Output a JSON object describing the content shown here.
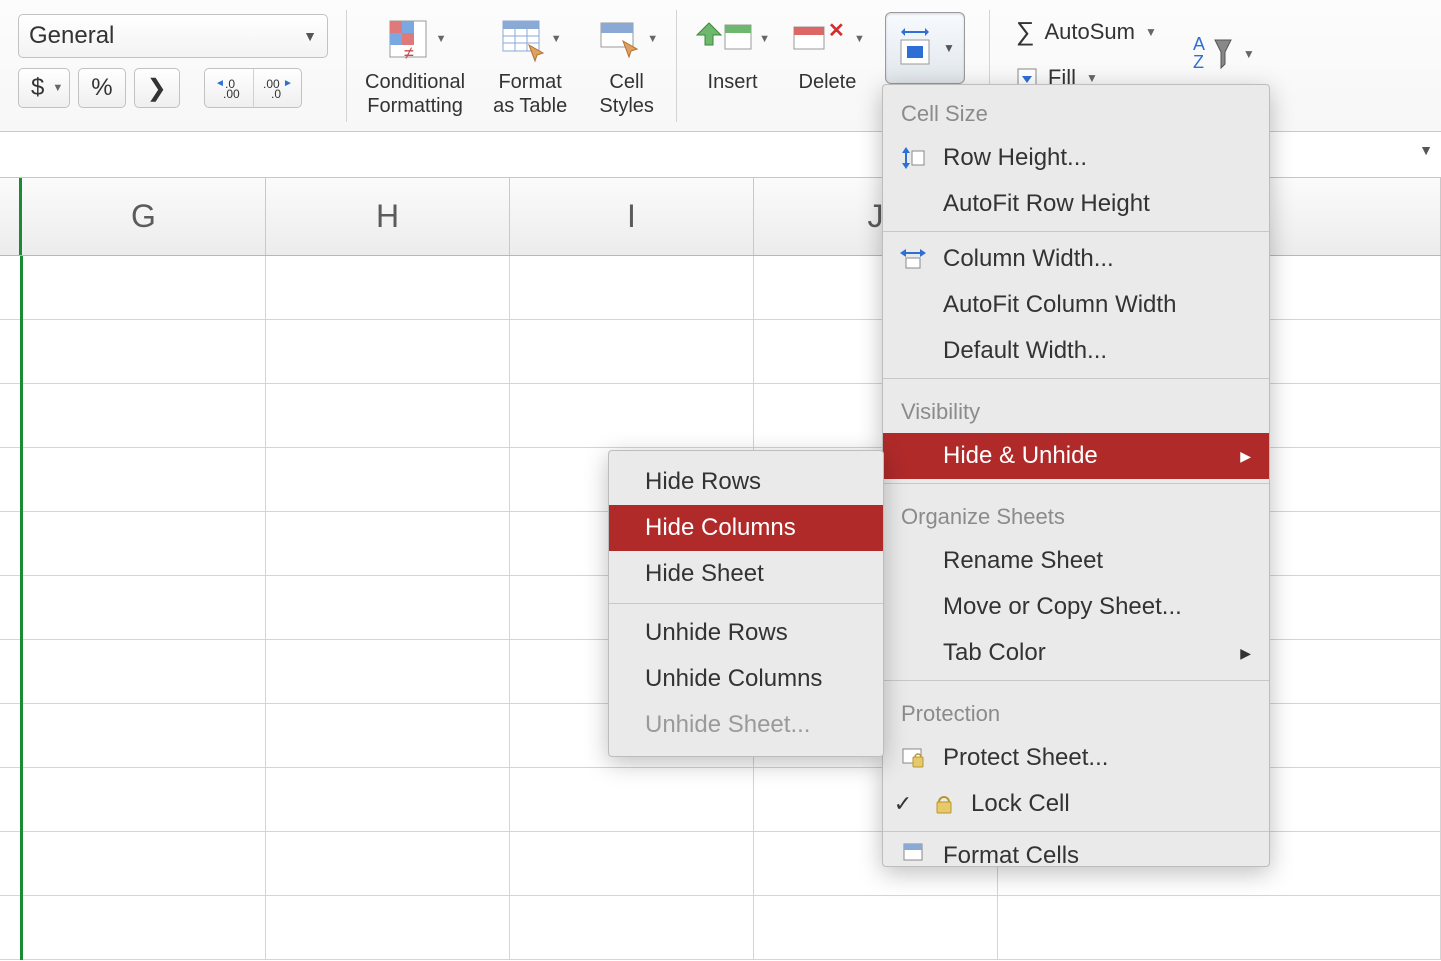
{
  "number_group": {
    "format_select": "General",
    "currency": "$",
    "percent": "%",
    "comma": "❯"
  },
  "styles_group": {
    "conditional_formatting": "Conditional\nFormatting",
    "format_as_table": "Format\nas Table",
    "cell_styles": "Cell\nStyles"
  },
  "cells_group": {
    "insert": "Insert",
    "delete": "Delete"
  },
  "editing_group": {
    "autosum": "AutoSum",
    "fill": "Fill"
  },
  "columns": [
    "G",
    "H",
    "I",
    "J"
  ],
  "format_menu": {
    "section_cell_size": "Cell Size",
    "row_height": "Row Height...",
    "autofit_row_height": "AutoFit Row Height",
    "column_width": "Column Width...",
    "autofit_column_width": "AutoFit Column Width",
    "default_width": "Default Width...",
    "section_visibility": "Visibility",
    "hide_unhide": "Hide & Unhide",
    "section_organize": "Organize Sheets",
    "rename_sheet": "Rename Sheet",
    "move_or_copy_sheet": "Move or Copy Sheet...",
    "tab_color": "Tab Color",
    "section_protection": "Protection",
    "protect_sheet": "Protect Sheet...",
    "lock_cell": "Lock Cell",
    "format_cells": "Format Cells"
  },
  "hide_submenu": {
    "hide_rows": "Hide Rows",
    "hide_columns": "Hide Columns",
    "hide_sheet": "Hide Sheet",
    "unhide_rows": "Unhide Rows",
    "unhide_columns": "Unhide Columns",
    "unhide_sheet": "Unhide Sheet..."
  }
}
